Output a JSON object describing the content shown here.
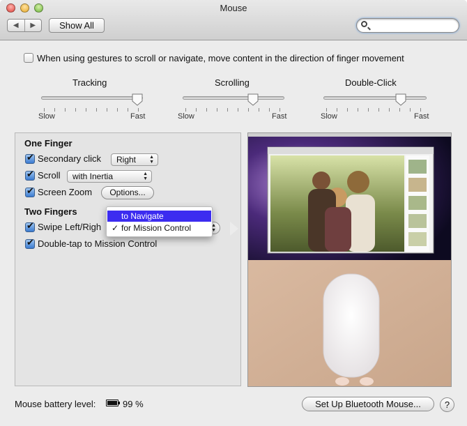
{
  "window": {
    "title": "Mouse"
  },
  "toolbar": {
    "back_icon": "chevron-left-icon",
    "forward_icon": "chevron-right-icon",
    "show_all_label": "Show All",
    "search_value": "",
    "search_icon": "magnifier-icon"
  },
  "gesture_option": {
    "checked": false,
    "label": "When using gestures to scroll or navigate, move content in the direction of finger movement"
  },
  "sliders": [
    {
      "label": "Tracking",
      "min_label": "Slow",
      "max_label": "Fast",
      "level": 0.95
    },
    {
      "label": "Scrolling",
      "min_label": "Slow",
      "max_label": "Fast",
      "level": 0.7
    },
    {
      "label": "Double-Click",
      "min_label": "Slow",
      "max_label": "Fast",
      "level": 0.75
    }
  ],
  "one_finger": {
    "heading": "One Finger",
    "secondary_click": {
      "label": "Secondary click",
      "checked": true,
      "value": "Right"
    },
    "scroll": {
      "label": "Scroll",
      "checked": true,
      "value": "with Inertia"
    },
    "screen_zoom": {
      "label": "Screen Zoom",
      "checked": true,
      "options_label": "Options..."
    }
  },
  "two_fingers": {
    "heading": "Two Fingers",
    "swipe": {
      "label": "Swipe Left/Righ",
      "checked": true
    },
    "double_tap": {
      "label": "Double-tap to Mission Control",
      "checked": true
    }
  },
  "swipe_menu": {
    "items": [
      {
        "label": "to Navigate",
        "highlighted": true,
        "checked": false
      },
      {
        "label": "for Mission Control",
        "highlighted": false,
        "checked": true
      }
    ],
    "checkmark": "✓"
  },
  "footer": {
    "battery_label": "Mouse battery level:",
    "battery_icon": "battery-icon",
    "battery_value": "99 %",
    "bluetooth_button": "Set Up Bluetooth Mouse...",
    "help_label": "?"
  },
  "colors": {
    "highlight": "#3c2cf0",
    "accent": "#3b7bd0"
  }
}
